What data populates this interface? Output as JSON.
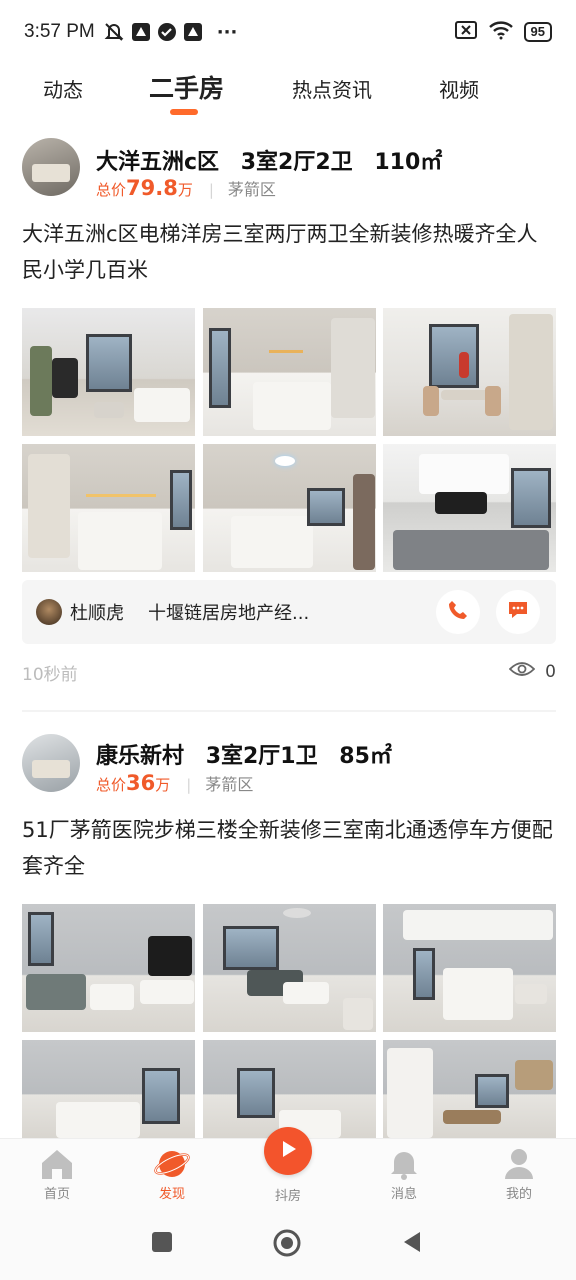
{
  "status_bar": {
    "time": "3:57 PM",
    "more": "···",
    "battery": "95"
  },
  "tabs": [
    {
      "label": "动态",
      "active": false
    },
    {
      "label": "二手房",
      "active": true
    },
    {
      "label": "热点资讯",
      "active": false
    },
    {
      "label": "视频",
      "active": false
    }
  ],
  "listings": [
    {
      "name": "大洋五洲c区",
      "layout": "3室2厅2卫",
      "area": "110㎡",
      "price_prefix": "总价",
      "price": "79.8",
      "price_unit": "万",
      "district": "茅箭区",
      "description": "大洋五洲c区电梯洋房三室两厅两卫全新装修热暖齐全人民小学几百米",
      "agent_name": "杜顺虎",
      "agent_company": "十堰链居房地产经...",
      "time_ago": "10秒前",
      "view_count": "0"
    },
    {
      "name": "康乐新村",
      "layout": "3室2厅1卫",
      "area": "85㎡",
      "price_prefix": "总价",
      "price": "36",
      "price_unit": "万",
      "district": "茅箭区",
      "description": "51厂茅箭医院步梯三楼全新装修三室南北通透停车方便配套齐全"
    }
  ],
  "bottom_nav": [
    {
      "label": "首页",
      "icon": "home-icon",
      "active": false
    },
    {
      "label": "发现",
      "icon": "planet-icon",
      "active": true
    },
    {
      "label": "抖房",
      "icon": "play-icon",
      "active": false
    },
    {
      "label": "消息",
      "icon": "bell-icon",
      "active": false
    },
    {
      "label": "我的",
      "icon": "user-icon",
      "active": false
    }
  ],
  "colors": {
    "accent": "#f05a2a",
    "tab_indicator": "#ff6a2b",
    "muted": "#888888"
  }
}
